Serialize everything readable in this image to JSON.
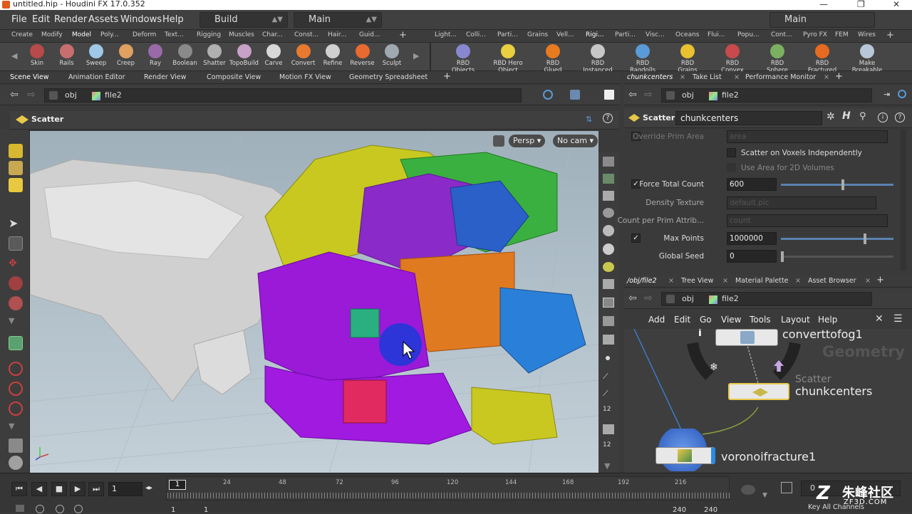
{
  "titlebar": {
    "title": "untitled.hip - Houdini FX 17.0.352",
    "minimize": "—",
    "maximize": "❐",
    "close": "✕"
  },
  "menu": {
    "items": [
      "File",
      "Edit",
      "Render",
      "Assets",
      "Windows",
      "Help"
    ],
    "desktop": "Build",
    "main_dd": "Main",
    "right_main": "Main"
  },
  "shelf_tabs_left": [
    "Create",
    "Modify",
    "Model",
    "Poly...",
    "Deform",
    "Text...",
    "Rigging",
    "Muscles",
    "Char...",
    "Const...",
    "Hair...",
    "Guid..."
  ],
  "shelf_tabs_right": [
    "Light...",
    "Colli...",
    "Parti...",
    "Grains",
    "Vell...",
    "Rigi...",
    "Parti...",
    "Visc...",
    "Oceans",
    "Flui...",
    "Popu...",
    "Cont...",
    "Pyro FX",
    "FEM",
    "Wires"
  ],
  "shelf_active_left": "Model",
  "shelf_active_right": "Rigi...",
  "tools_left": [
    {
      "label": "Skin",
      "color": "#b84a4a"
    },
    {
      "label": "Rails",
      "color": "#c86e6e"
    },
    {
      "label": "Sweep",
      "color": "#9fc8e8"
    },
    {
      "label": "Creep",
      "color": "#e0a060"
    },
    {
      "label": "Ray",
      "color": "#9a6aa8"
    },
    {
      "label": "Boolean",
      "color": "#8a8a8a"
    },
    {
      "label": "Shatter",
      "color": "#b0b0b0"
    },
    {
      "label": "TopoBuild",
      "color": "#c8a0c8"
    },
    {
      "label": "Carve",
      "color": "#d8d8d8"
    },
    {
      "label": "Convert",
      "color": "#e87a30"
    },
    {
      "label": "Refine",
      "color": "#d0d0d0"
    },
    {
      "label": "Reverse",
      "color": "#e86a30"
    },
    {
      "label": "Sculpt",
      "color": "#a0a8b0"
    }
  ],
  "tools_right": [
    {
      "label": "RBD Objects",
      "color": "#8888d0"
    },
    {
      "label": "RBD Hero Object",
      "color": "#e8d040"
    },
    {
      "label": "RBD Glued Objects",
      "color": "#e87a20"
    },
    {
      "label": "RBD Instanced Objects",
      "color": "#c8c8c8"
    },
    {
      "label": "RBD Ragdolls",
      "color": "#5a9ad8"
    },
    {
      "label": "RBD Grains",
      "color": "#e8c030"
    },
    {
      "label": "RBD Convex Proxy",
      "color": "#c84a4a"
    },
    {
      "label": "RBD Sphere Proxy",
      "color": "#7ab060"
    },
    {
      "label": "RBD Fractured Object",
      "color": "#e86a20"
    },
    {
      "label": "Make Breakable",
      "color": "#b8c8d8"
    }
  ],
  "pane_tabs_left": [
    "Scene View",
    "Animation Editor",
    "Render View",
    "Composite View",
    "Motion FX View",
    "Geometry Spreadsheet"
  ],
  "pane_tabs_right": [
    "chunkcenters",
    "Take List",
    "Performance Monitor"
  ],
  "path": {
    "obj": "obj",
    "file": "file2"
  },
  "viewport": {
    "node_label": "Scatter",
    "persp": "Persp",
    "cam": "No cam"
  },
  "parm": {
    "node_type": "Scatter",
    "node_name": "chunkcenters",
    "rows": [
      {
        "label": "Override Prim Area",
        "value": "area",
        "dim": true
      },
      {
        "label": "Scatter on Voxels Independently"
      },
      {
        "label": "Use Area for 2D Volumes"
      },
      {
        "label": "Force Total Count",
        "value": "600",
        "checked": "✓",
        "slider": 0.55
      },
      {
        "label": "Density Texture",
        "value": "default.pic",
        "dim": true
      },
      {
        "label": "Count per Prim Attrib...",
        "value": "count",
        "dim": true
      },
      {
        "label": "Max Points",
        "value": "1000000",
        "checked": "✓",
        "slider": 0.75
      },
      {
        "label": "Global Seed",
        "value": "0",
        "slider": 0.0
      }
    ]
  },
  "net_tabs": [
    "/obj/file2",
    "Tree View",
    "Material Palette",
    "Asset Browser"
  ],
  "net_menu": [
    "Add",
    "Edit",
    "Go",
    "View",
    "Tools",
    "Layout",
    "Help"
  ],
  "network": {
    "context": "Geometry",
    "nodes": [
      {
        "name": "converttofog1"
      },
      {
        "type": "Scatter",
        "name": "chunkcenters"
      },
      {
        "name": "voronoifracture1"
      }
    ]
  },
  "timeline": {
    "frame": "1",
    "current": "1",
    "ticks": [
      "24",
      "48",
      "72",
      "96",
      "120",
      "144",
      "168",
      "192",
      "216"
    ],
    "start": "1",
    "end": "1",
    "range_a": "240",
    "range_b": "240",
    "key_all": "Key All Channels",
    "zero": "0"
  },
  "watermark": {
    "cn": "朱峰社区",
    "url": "ZF3D.COM"
  }
}
